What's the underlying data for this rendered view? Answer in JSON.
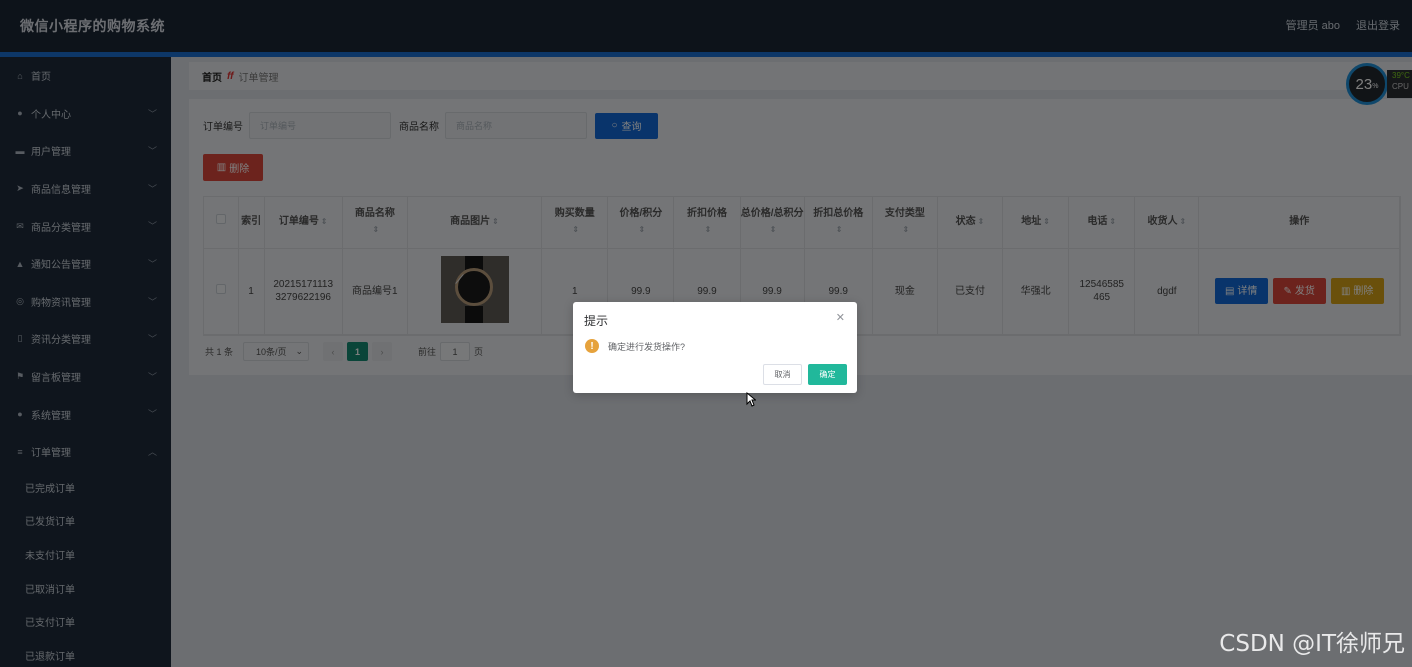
{
  "header": {
    "title": "微信小程序的购物系统",
    "admin": "管理员 abo",
    "logout": "退出登录"
  },
  "sidebar": {
    "items": [
      {
        "label": "首页",
        "icon": "home-icon",
        "glyph": "⌂",
        "has_sub": false
      },
      {
        "label": "个人中心",
        "icon": "user-icon",
        "glyph": "●",
        "has_sub": true
      },
      {
        "label": "用户管理",
        "icon": "monitor-icon",
        "glyph": "▬",
        "has_sub": true
      },
      {
        "label": "商品信息管理",
        "icon": "send-icon",
        "glyph": "➤",
        "has_sub": true
      },
      {
        "label": "商品分类管理",
        "icon": "mail-icon",
        "glyph": "✉",
        "has_sub": true
      },
      {
        "label": "通知公告管理",
        "icon": "thumb-icon",
        "glyph": "▲",
        "has_sub": true
      },
      {
        "label": "购物资讯管理",
        "icon": "compass-icon",
        "glyph": "◎",
        "has_sub": true
      },
      {
        "label": "资讯分类管理",
        "icon": "phone-icon",
        "glyph": "▯",
        "has_sub": true
      },
      {
        "label": "留言板管理",
        "icon": "flag-icon",
        "glyph": "⚑",
        "has_sub": true
      },
      {
        "label": "系统管理",
        "icon": "user-icon",
        "glyph": "●",
        "has_sub": true
      },
      {
        "label": "订单管理",
        "icon": "menu-icon",
        "glyph": "≡",
        "has_sub": true,
        "open": true
      }
    ],
    "sub_items": [
      "已完成订单",
      "已发货订单",
      "未支付订单",
      "已取消订单",
      "已支付订单",
      "已退款订单"
    ]
  },
  "breadcrumb": {
    "home": "首页",
    "current": "订单管理"
  },
  "search": {
    "order_label": "订单编号",
    "order_placeholder": "订单编号",
    "goods_label": "商品名称",
    "goods_placeholder": "商品名称",
    "query": "查询"
  },
  "toolbar": {
    "delete": "删除"
  },
  "table": {
    "headers": [
      "",
      "索引",
      "订单编号",
      "商品名称",
      "商品图片",
      "购买数量",
      "价格/积分",
      "折扣价格",
      "总价格/总积分",
      "折扣总价格",
      "支付类型",
      "状态",
      "地址",
      "电话",
      "收货人",
      "操作"
    ],
    "rows": [
      {
        "index": "1",
        "order_no": "202151711133279622196",
        "goods_name": "商品编号1",
        "quantity": "1",
        "price": "99.9",
        "discount_price": "99.9",
        "total": "99.9",
        "discount_total": "99.9",
        "pay_type": "现金",
        "status": "已支付",
        "address": "华强北",
        "phone": "12546585465",
        "receiver": "dgdf"
      }
    ],
    "actions": {
      "detail": "详情",
      "ship": "发货",
      "delete": "删除"
    }
  },
  "pager": {
    "total": "共 1 条",
    "page_size": "10条/页",
    "current_page": "1",
    "goto_label": "前往",
    "goto_value": "1",
    "page_unit": "页"
  },
  "dialog": {
    "title": "提示",
    "message": "确定进行发货操作?",
    "cancel": "取消",
    "confirm": "确定"
  },
  "cpu_widget": {
    "percent": "23",
    "unit": "%",
    "temp": "39°C",
    "label": "CPU"
  },
  "watermark": "CSDN @IT徐师兄",
  "colors": {
    "header": "#1b2634",
    "sidebar": "#1f2b3a",
    "primary": "#1369d6",
    "danger": "#d9473a",
    "warning": "#d4a017",
    "success": "#21b89b"
  }
}
